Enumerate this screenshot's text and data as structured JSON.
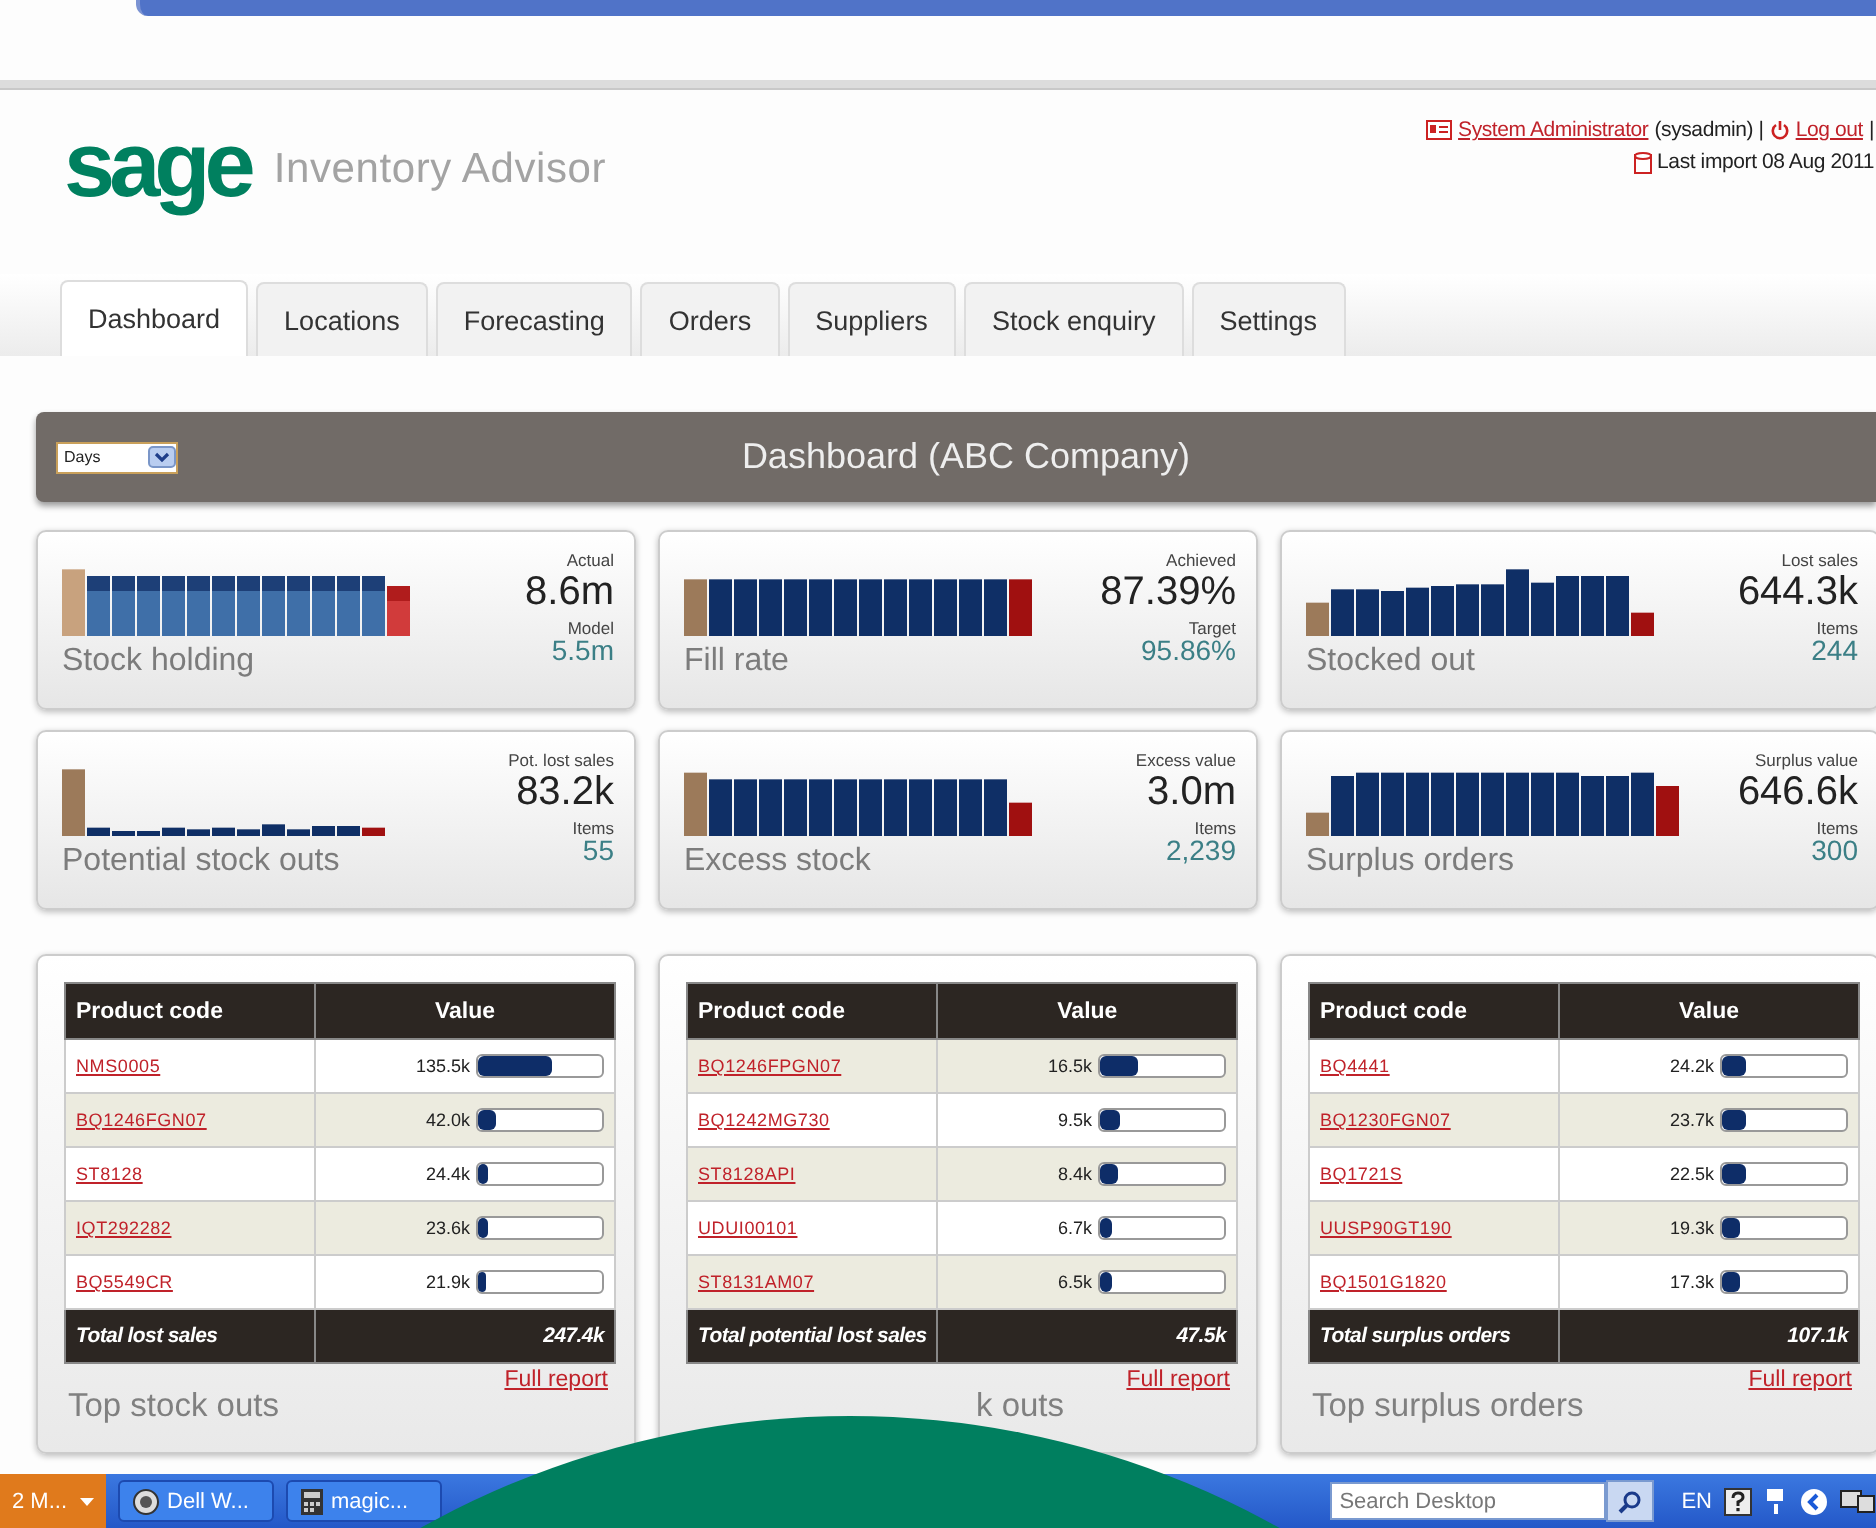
{
  "header": {
    "logo": "sage",
    "product": "Inventory Advisor",
    "user_link": "System Administrator",
    "user_id": "(sysadmin) |",
    "logout": "Log out",
    "trailing": "|",
    "last_import": "Last import 08 Aug 2011"
  },
  "tabs": [
    {
      "label": "Dashboard",
      "selected": true
    },
    {
      "label": "Locations",
      "selected": false
    },
    {
      "label": "Forecasting",
      "selected": false
    },
    {
      "label": "Orders",
      "selected": false
    },
    {
      "label": "Suppliers",
      "selected": false
    },
    {
      "label": "Stock enquiry",
      "selected": false
    },
    {
      "label": "Settings",
      "selected": false
    }
  ],
  "toolbar": {
    "period": "Days",
    "title": "Dashboard (ABC Company)"
  },
  "kpi_cards": [
    {
      "title": "Stock holding",
      "label_1": "Actual",
      "value_1": "8.6m",
      "label_2": "Model",
      "value_2": "5.5m"
    },
    {
      "title": "Fill rate",
      "label_1": "Achieved",
      "value_1": "87.39%",
      "label_2": "Target",
      "value_2": "95.86%"
    },
    {
      "title": "Stocked out",
      "label_1": "Lost sales",
      "value_1": "644.3k",
      "label_2": "Items",
      "value_2": "244"
    },
    {
      "title": "Potential stock outs",
      "label_1": "Pot. lost sales",
      "value_1": "83.2k",
      "label_2": "Items",
      "value_2": "55"
    },
    {
      "title": "Excess stock",
      "label_1": "Excess value",
      "value_1": "3.0m",
      "label_2": "Items",
      "value_2": "2,239"
    },
    {
      "title": "Surplus orders",
      "label_1": "Surplus value",
      "value_1": "646.6k",
      "label_2": "Items",
      "value_2": "300"
    }
  ],
  "tables": [
    {
      "columns": [
        "Product code",
        "Value"
      ],
      "rows": [
        {
          "code": "NMS0005",
          "value": "135.5k",
          "level": 0.6,
          "shaded": false
        },
        {
          "code": "BQ1246FGN07",
          "value": "42.0k",
          "level": 0.15,
          "shaded": true
        },
        {
          "code": "ST8128",
          "value": "24.4k",
          "level": 0.08,
          "shaded": false
        },
        {
          "code": "IQT292282",
          "value": "23.6k",
          "level": 0.08,
          "shaded": true
        },
        {
          "code": "BQ5549CR",
          "value": "21.9k",
          "level": 0.07,
          "shaded": false
        }
      ],
      "total_label": "Total lost sales",
      "total": "247.4k",
      "link": "Full report",
      "title": "Top stock outs"
    },
    {
      "columns": [
        "Product code",
        "Value"
      ],
      "rows": [
        {
          "code": "BQ1246FPGN07",
          "value": "16.5k",
          "level": 0.3,
          "shaded": true
        },
        {
          "code": "BQ1242MG730",
          "value": "9.5k",
          "level": 0.16,
          "shaded": false
        },
        {
          "code": "ST8128API",
          "value": "8.4k",
          "level": 0.15,
          "shaded": true
        },
        {
          "code": "UDUI00101",
          "value": "6.7k",
          "level": 0.1,
          "shaded": false
        },
        {
          "code": "ST8131AM07",
          "value": "6.5k",
          "level": 0.1,
          "shaded": true
        }
      ],
      "total_label": "Total potential lost sales",
      "total": "47.5k",
      "link": "Full report",
      "title": "k outs"
    },
    {
      "columns": [
        "Product code",
        "Value"
      ],
      "rows": [
        {
          "code": "BQ4441",
          "value": "24.2k",
          "level": 0.2,
          "shaded": false
        },
        {
          "code": "BQ1230FGN07",
          "value": "23.7k",
          "level": 0.2,
          "shaded": true
        },
        {
          "code": "BQ1721S",
          "value": "22.5k",
          "level": 0.2,
          "shaded": false
        },
        {
          "code": "UUSP90GT190",
          "value": "19.3k",
          "level": 0.15,
          "shaded": true
        },
        {
          "code": "BQ1501G1820",
          "value": "17.3k",
          "level": 0.14,
          "shaded": false
        }
      ],
      "total_label": "Total surplus orders",
      "total": "107.1k",
      "link": "Full report",
      "title": "Top surplus orders"
    }
  ],
  "taskbar": {
    "start": "2 M...",
    "items": [
      "Dell W...",
      "magic..."
    ],
    "search_placeholder": "Search Desktop",
    "language": "EN"
  }
}
